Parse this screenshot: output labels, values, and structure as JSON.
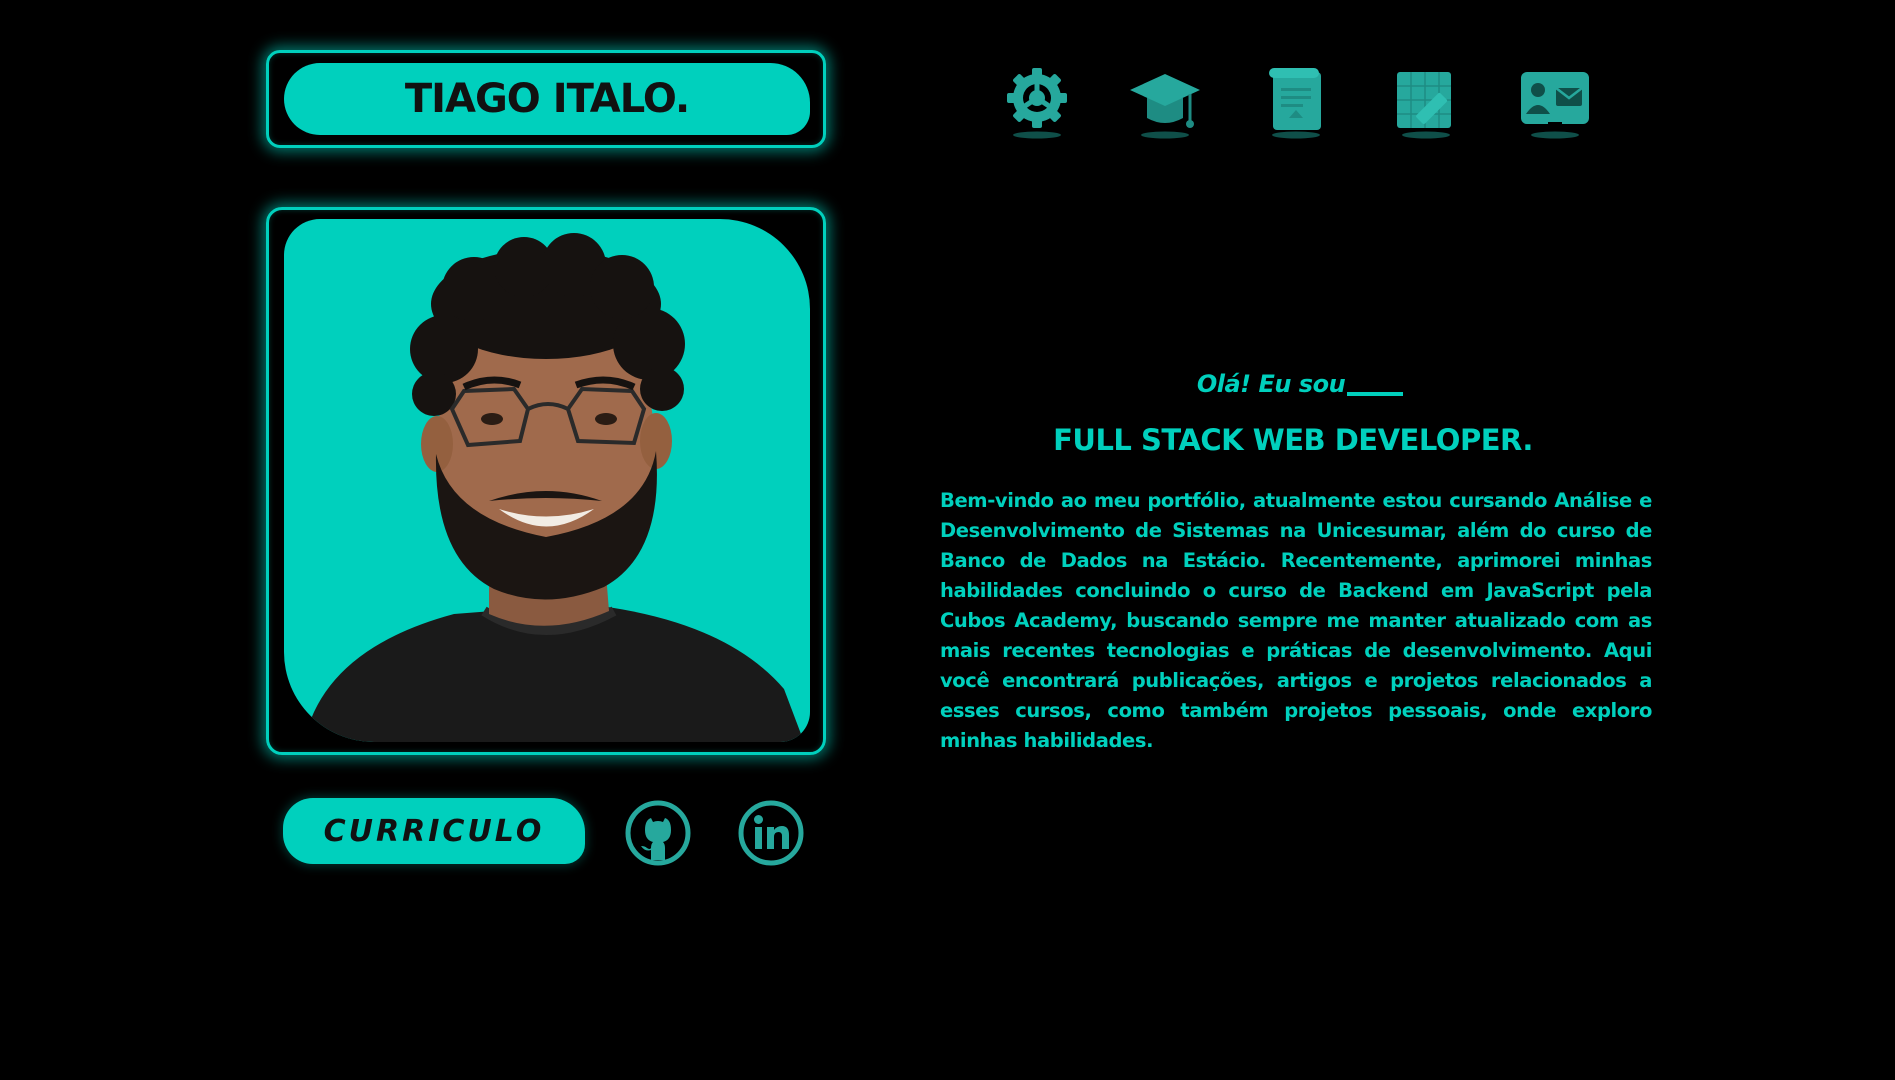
{
  "header": {
    "name": "TIAGO ITALO."
  },
  "nav": {
    "items": [
      {
        "icon": "gear-icon"
      },
      {
        "icon": "graduation-cap-icon"
      },
      {
        "icon": "scroll-document-icon"
      },
      {
        "icon": "blueprint-ruler-icon"
      },
      {
        "icon": "contact-card-icon"
      }
    ]
  },
  "profile": {
    "photo_alt": "portrait"
  },
  "actions": {
    "cv_label": "CURRICULO",
    "github_icon": "github-icon",
    "linkedin_icon": "linkedin-icon"
  },
  "intro": {
    "greeting": "Olá! Eu sou",
    "role": "FULL STACK WEB DEVELOPER.",
    "bio": "Bem-vindo ao meu portfólio, atualmente estou cursando Análise e Desenvolvimento de Sistemas na Unicesumar, além do curso de Banco de Dados na Estácio. Recentemente, aprimorei minhas habilidades concluindo o curso de Backend em JavaScript pela Cubos Academy, buscando sempre me manter atualizado com as mais recentes tecnologias e práticas de desenvolvimento. Aqui você encontrará publicações, artigos e projetos relacionados a esses cursos, como também projetos pessoais, onde exploro minhas habilidades."
  },
  "colors": {
    "accent": "#00d0bd",
    "icon_fill": "#26a89d",
    "background": "#000000",
    "text_dark": "#111111"
  }
}
